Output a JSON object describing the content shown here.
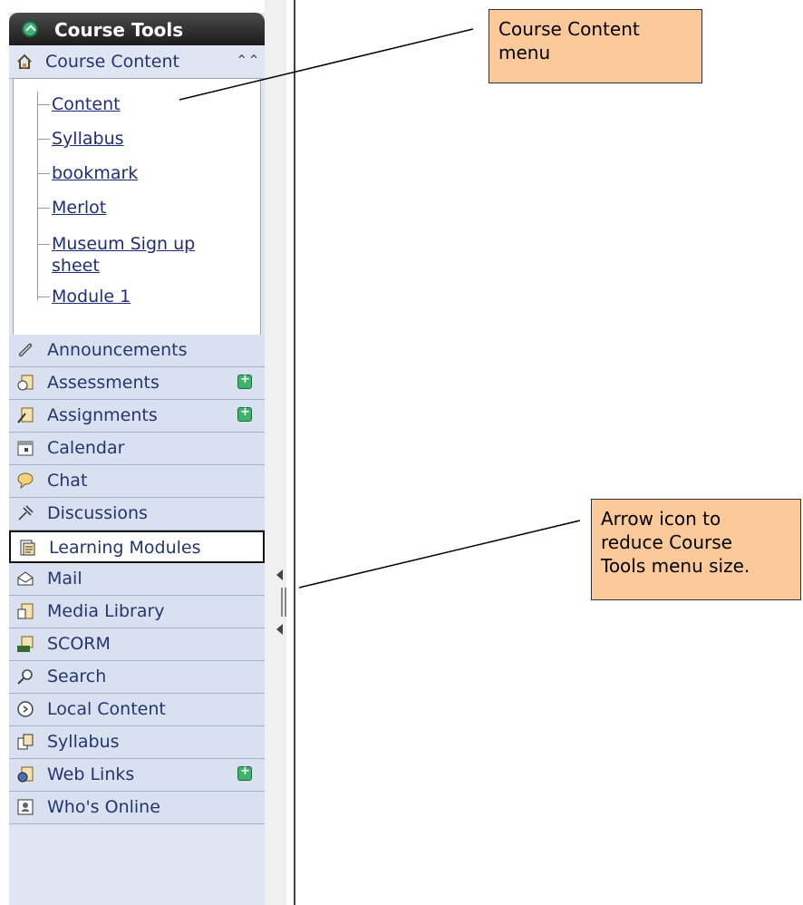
{
  "panel": {
    "title": "Course Tools",
    "course_content": {
      "label": "Course Content",
      "items": [
        "Content",
        "Syllabus",
        "bookmark",
        "Merlot",
        "Museum Sign up",
        "sheet",
        "Module 1"
      ]
    },
    "tools": [
      {
        "label": "Announcements",
        "icon": "megaphone-icon",
        "badge": false
      },
      {
        "label": "Assessments",
        "icon": "assessments-icon",
        "badge": true
      },
      {
        "label": "Assignments",
        "icon": "assignments-icon",
        "badge": true
      },
      {
        "label": "Calendar",
        "icon": "calendar-icon",
        "badge": false
      },
      {
        "label": "Chat",
        "icon": "chat-icon",
        "badge": false
      },
      {
        "label": "Discussions",
        "icon": "discussions-icon",
        "badge": false
      },
      {
        "label": "Learning Modules",
        "icon": "learning-modules-icon",
        "badge": false
      },
      {
        "label": "Mail",
        "icon": "mail-icon",
        "badge": false
      },
      {
        "label": "Media Library",
        "icon": "media-library-icon",
        "badge": false
      },
      {
        "label": "SCORM",
        "icon": "scorm-icon",
        "badge": false
      },
      {
        "label": "Search",
        "icon": "search-icon",
        "badge": false
      },
      {
        "label": "Local Content",
        "icon": "local-content-icon",
        "badge": false
      },
      {
        "label": "Syllabus",
        "icon": "syllabus-icon",
        "badge": false
      },
      {
        "label": "Web Links",
        "icon": "web-links-icon",
        "badge": true
      },
      {
        "label": "Who's Online",
        "icon": "whos-online-icon",
        "badge": false
      }
    ]
  },
  "callouts": {
    "course_content_line1": "Course Content",
    "course_content_line2": "menu",
    "arrow_line1": "Arrow icon to",
    "arrow_line2": "reduce Course",
    "arrow_line3": "Tools menu size."
  },
  "colors": {
    "callout_bg": "#fbc99a",
    "panel_bg": "#dfe5f2",
    "link": "#1f2e7a"
  }
}
